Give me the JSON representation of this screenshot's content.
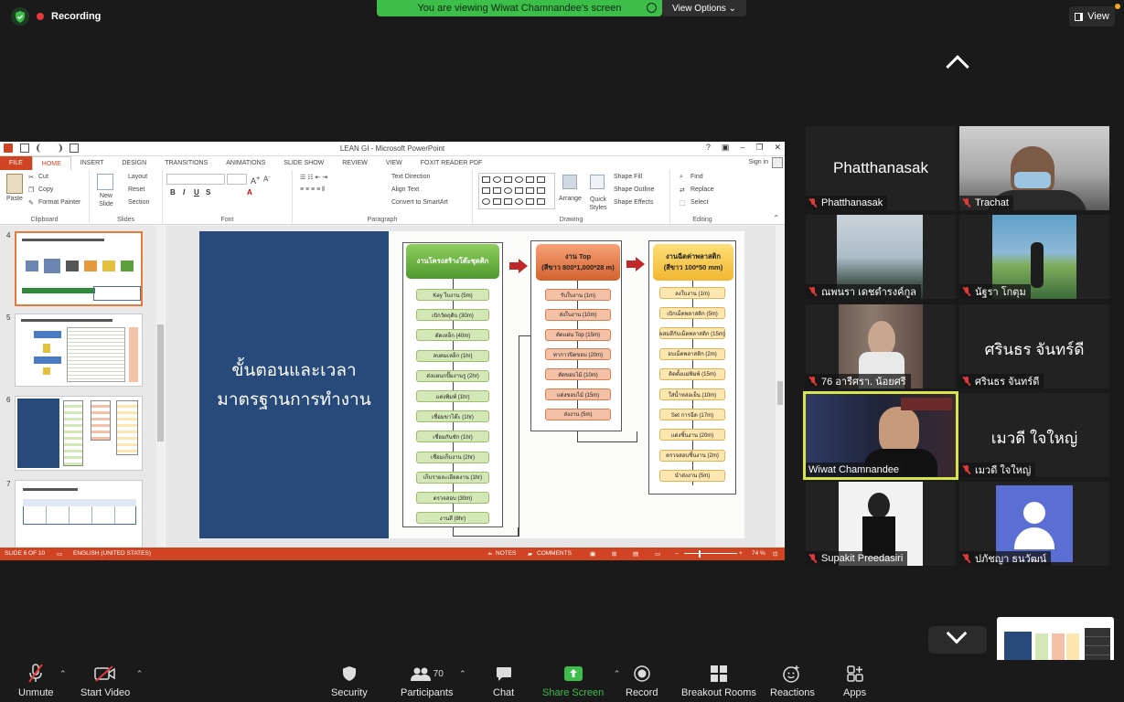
{
  "zoom": {
    "recording_label": "Recording",
    "share_banner": "You are viewing Wiwat  Chamnandee's screen",
    "view_options": "View Options",
    "view_button": "View"
  },
  "ppt": {
    "window_title": "LEAN GI - Microsoft PowerPoint",
    "tabs": [
      "FILE",
      "HOME",
      "INSERT",
      "DESIGN",
      "TRANSITIONS",
      "ANIMATIONS",
      "SLIDE SHOW",
      "REVIEW",
      "VIEW",
      "FOXIT READER PDF"
    ],
    "sign_in": "Sign in",
    "clipboard": {
      "paste": "Paste",
      "cut": "Cut",
      "copy": "Copy",
      "format_painter": "Format Painter",
      "label": "Clipboard"
    },
    "slides_group": {
      "new_slide": "New Slide",
      "layout": "Layout",
      "reset": "Reset",
      "section": "Section",
      "label": "Slides"
    },
    "font_group": {
      "label": "Font"
    },
    "paragraph_group": {
      "text_direction": "Text Direction",
      "align_text": "Align Text",
      "convert": "Convert to SmartArt",
      "label": "Paragraph"
    },
    "drawing_group": {
      "arrange": "Arrange",
      "quick_styles": "Quick Styles",
      "shape_fill": "Shape Fill",
      "shape_outline": "Shape Outline",
      "shape_effects": "Shape Effects",
      "label": "Drawing"
    },
    "editing_group": {
      "find": "Find",
      "replace": "Replace",
      "select": "Select",
      "label": "Editing"
    },
    "thumb_numbers": [
      "4",
      "5",
      "6",
      "7"
    ],
    "status": {
      "slide": "SLIDE 6 OF 10",
      "language": "ENGLISH (UNITED STATES)",
      "notes": "NOTES",
      "comments": "COMMENTS",
      "zoom": "74 %"
    }
  },
  "slide": {
    "title": "ขั้นตอนและเวลามาตรฐานการทำงาน",
    "col1": {
      "head": "งานโครงสร้างโต๊ะชุดคิก",
      "steps": [
        "Key ใบงาน (5m)",
        "เบิกวัตถุดิบ (30m)",
        "ตัดเหล็ก (40m)",
        "ลบคมเหล็ก (1hr)",
        "ส่งแผนกปั๊มงานรู (2hr)",
        "แต่งพิมพ์ (1hr)",
        "เชื่อมขาโต๊ะ (1hr)",
        "เชื่อมกันชัก (1hr)",
        "เชื่อมเก็บงาน (2hr)",
        "เก็บรายละเอียดงาน (1hr)",
        "ตรวจสอบ (30m)",
        "งานสี (8hr)"
      ]
    },
    "col2": {
      "head1": "งาน Top",
      "head2": "(สีขาว 800*1,000*28 m)",
      "steps": [
        "รับใบงาน (1m)",
        "ส่งใบงาน (10m)",
        "ตัดแผ่น Top (15m)",
        "ทากาวปิดขอบ (20m)",
        "ตัดขอบไม้ (10m)",
        "แต่งขอบไม้ (15m)",
        "ส่งงาน (5m)"
      ]
    },
    "col3": {
      "head1": "งานฉีดค่าพลาสติก",
      "head2": "(สีขาว 100*50 mm)",
      "steps": [
        "ลงใบงาน (1m)",
        "เบิกเม็ดพลาสติก (5m)",
        "ผสมสีกับเม็ดพลาสติก (15m)",
        "อบเม็ดพลาสติก (2m)",
        "ติดตั้งแม่พิมพ์ (15m)",
        "ใส่น้ำหล่อเย็น (10m)",
        "Set การฉีด (17m)",
        "แต่งชิ้นงาน (20m)",
        "ตรวจสอบชิ้นงาน (2m)",
        "นำส่งงาน (5m)"
      ]
    }
  },
  "participants": [
    {
      "name": "Phatthanasak",
      "big": "Phatthanasak"
    },
    {
      "name": "Trachat"
    },
    {
      "name": "ณพนรา เดชดำรงค์กูล"
    },
    {
      "name": "นัฐรา โกตุม"
    },
    {
      "name": "76 อารีศรา. น้อยศรี"
    },
    {
      "name": "ศรินธร จันทร์ดี",
      "big": "ศรินธร จันทร์ดี"
    },
    {
      "name": "Wiwat  Chamnandee"
    },
    {
      "name": "เมวดี ใจใหญ่",
      "big": "เมวดี ใจใหญ่"
    },
    {
      "name": "Supakit Preedasiri"
    },
    {
      "name": "ปภัชญา ธนวัฒน์"
    }
  ],
  "toolbar": {
    "unmute": "Unmute",
    "start_video": "Start Video",
    "security": "Security",
    "participants": "Participants",
    "participants_count": "70",
    "chat": "Chat",
    "share_screen": "Share Screen",
    "record": "Record",
    "breakout_rooms": "Breakout Rooms",
    "reactions": "Reactions",
    "apps": "Apps"
  },
  "colors": {
    "share_green": "#3dbe4a",
    "ppt_orange": "#d04423",
    "slide_blue": "#274a7b",
    "active_speaker": "#d9e34b"
  }
}
